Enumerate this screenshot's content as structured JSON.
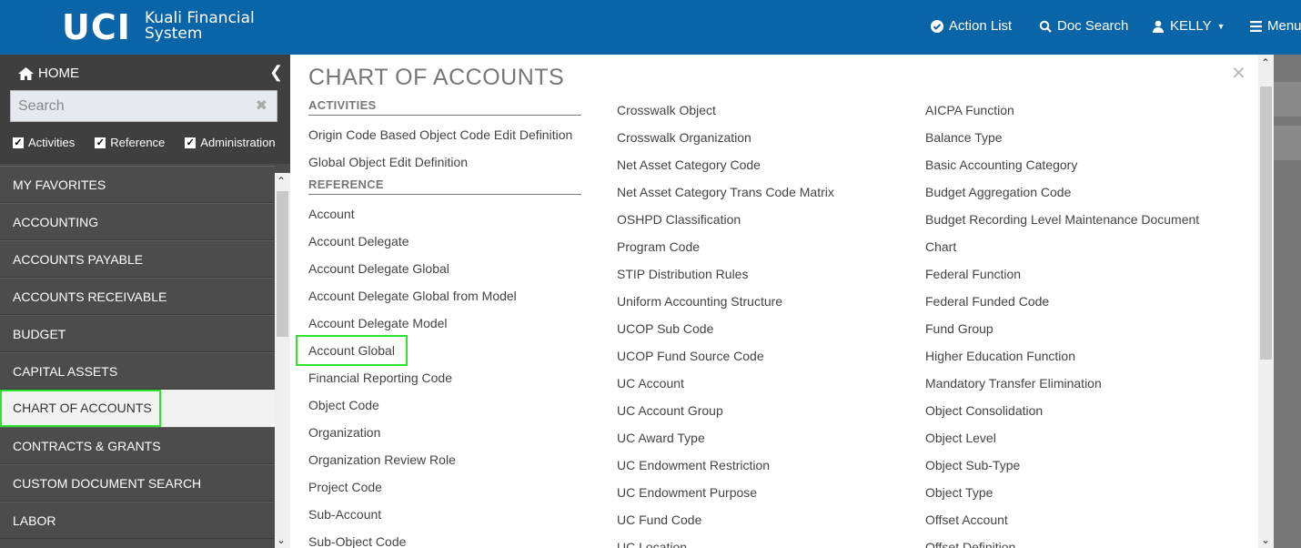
{
  "header": {
    "logo": "UCI",
    "app_name_line1": "Kuali Financial",
    "app_name_line2": "System",
    "action_list": "Action List",
    "doc_search": "Doc Search",
    "user": "KELLY",
    "menu": "Menu"
  },
  "sidebar": {
    "home": "HOME",
    "search_placeholder": "Search",
    "filters": [
      "Activities",
      "Reference",
      "Administration"
    ],
    "items": [
      "MY FAVORITES",
      "ACCOUNTING",
      "ACCOUNTS PAYABLE",
      "ACCOUNTS RECEIVABLE",
      "BUDGET",
      "CAPITAL ASSETS",
      "CHART OF ACCOUNTS",
      "CONTRACTS & GRANTS",
      "CUSTOM DOCUMENT SEARCH",
      "LABOR"
    ],
    "active_item": "CHART OF ACCOUNTS"
  },
  "panel": {
    "title": "CHART OF ACCOUNTS",
    "activities_heading": "ACTIVITIES",
    "activities": [
      "Origin Code Based Object Code Edit Definition",
      "Global Object Edit Definition"
    ],
    "reference_heading": "REFERENCE",
    "col1_reference": [
      "Account",
      "Account Delegate",
      "Account Delegate Global",
      "Account Delegate Global from Model",
      "Account Delegate Model",
      "Account Global",
      "Financial Reporting Code",
      "Object Code",
      "Organization",
      "Organization Review Role",
      "Project Code",
      "Sub-Account",
      "Sub-Object Code"
    ],
    "col2": [
      "Crosswalk Object",
      "Crosswalk Organization",
      "Net Asset Category Code",
      "Net Asset Category Trans Code Matrix",
      "OSHPD Classification",
      "Program Code",
      "STIP Distribution Rules",
      "Uniform Accounting Structure",
      "UCOP Sub Code",
      "UCOP Fund Source Code",
      "UC Account",
      "UC Account Group",
      "UC Award Type",
      "UC Endowment Restriction",
      "UC Endowment Purpose",
      "UC Fund Code",
      "UC Location"
    ],
    "col3": [
      "AICPA Function",
      "Balance Type",
      "Basic Accounting Category",
      "Budget Aggregation Code",
      "Budget Recording Level Maintenance Document",
      "Chart",
      "Federal Function",
      "Federal Funded Code",
      "Fund Group",
      "Higher Education Function",
      "Mandatory Transfer Elimination",
      "Object Consolidation",
      "Object Level",
      "Object Sub-Type",
      "Object Type",
      "Offset Account",
      "Offset Definition"
    ],
    "highlighted_link": "Account Global"
  },
  "colors": {
    "header_bg": "#0a64a8",
    "sidebar_bg": "#4c4c4c",
    "highlight": "#2ee52e"
  }
}
